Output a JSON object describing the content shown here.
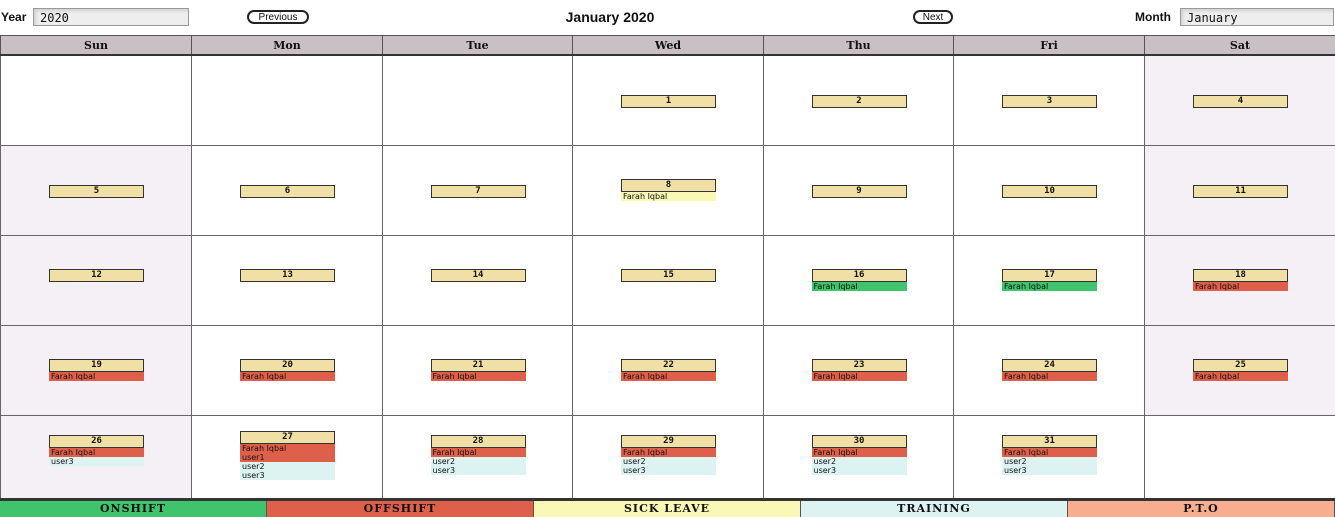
{
  "header": {
    "year_label": "Year",
    "year_value": "2020",
    "prev_label": "Previous",
    "title": "January 2020",
    "next_label": "Next",
    "month_label": "Month",
    "month_value": "January"
  },
  "weekdays": [
    "Sun",
    "Mon",
    "Tue",
    "Wed",
    "Thu",
    "Fri",
    "Sat"
  ],
  "weeks": [
    [
      {
        "day": "",
        "weekend": false,
        "events": []
      },
      {
        "day": "",
        "weekend": false,
        "events": []
      },
      {
        "day": "",
        "weekend": false,
        "events": []
      },
      {
        "day": "1",
        "weekend": false,
        "events": []
      },
      {
        "day": "2",
        "weekend": false,
        "events": []
      },
      {
        "day": "3",
        "weekend": false,
        "events": []
      },
      {
        "day": "4",
        "weekend": true,
        "events": []
      }
    ],
    [
      {
        "day": "5",
        "weekend": true,
        "events": []
      },
      {
        "day": "6",
        "weekend": false,
        "events": []
      },
      {
        "day": "7",
        "weekend": false,
        "events": []
      },
      {
        "day": "8",
        "weekend": false,
        "events": [
          {
            "name": "Farah Iqbal",
            "type": "sick"
          }
        ]
      },
      {
        "day": "9",
        "weekend": false,
        "events": []
      },
      {
        "day": "10",
        "weekend": false,
        "events": []
      },
      {
        "day": "11",
        "weekend": true,
        "events": []
      }
    ],
    [
      {
        "day": "12",
        "weekend": true,
        "events": []
      },
      {
        "day": "13",
        "weekend": false,
        "events": []
      },
      {
        "day": "14",
        "weekend": false,
        "events": []
      },
      {
        "day": "15",
        "weekend": false,
        "events": []
      },
      {
        "day": "16",
        "weekend": false,
        "events": [
          {
            "name": "Farah Iqbal",
            "type": "onshift"
          }
        ]
      },
      {
        "day": "17",
        "weekend": false,
        "events": [
          {
            "name": "Farah Iqbal",
            "type": "onshift"
          }
        ]
      },
      {
        "day": "18",
        "weekend": true,
        "events": [
          {
            "name": "Farah Iqbal",
            "type": "offshift"
          }
        ]
      }
    ],
    [
      {
        "day": "19",
        "weekend": true,
        "events": [
          {
            "name": "Farah Iqbal",
            "type": "offshift"
          }
        ]
      },
      {
        "day": "20",
        "weekend": false,
        "events": [
          {
            "name": "Farah Iqbal",
            "type": "offshift"
          }
        ]
      },
      {
        "day": "21",
        "weekend": false,
        "events": [
          {
            "name": "Farah Iqbal",
            "type": "offshift"
          }
        ]
      },
      {
        "day": "22",
        "weekend": false,
        "events": [
          {
            "name": "Farah Iqbal",
            "type": "offshift"
          }
        ]
      },
      {
        "day": "23",
        "weekend": false,
        "events": [
          {
            "name": "Farah Iqbal",
            "type": "offshift"
          }
        ]
      },
      {
        "day": "24",
        "weekend": false,
        "events": [
          {
            "name": "Farah Iqbal",
            "type": "offshift"
          }
        ]
      },
      {
        "day": "25",
        "weekend": true,
        "events": [
          {
            "name": "Farah Iqbal",
            "type": "offshift"
          }
        ]
      }
    ],
    [
      {
        "day": "26",
        "weekend": true,
        "events": [
          {
            "name": "Farah Iqbal",
            "type": "offshift"
          },
          {
            "name": "user3",
            "type": "training"
          }
        ]
      },
      {
        "day": "27",
        "weekend": false,
        "events": [
          {
            "name": "Farah Iqbal",
            "type": "offshift"
          },
          {
            "name": "user1",
            "type": "offshift"
          },
          {
            "name": "user2",
            "type": "training"
          },
          {
            "name": "user3",
            "type": "training"
          }
        ]
      },
      {
        "day": "28",
        "weekend": false,
        "events": [
          {
            "name": "Farah Iqbal",
            "type": "offshift"
          },
          {
            "name": "user2",
            "type": "training"
          },
          {
            "name": "user3",
            "type": "training"
          }
        ]
      },
      {
        "day": "29",
        "weekend": false,
        "events": [
          {
            "name": "Farah Iqbal",
            "type": "offshift"
          },
          {
            "name": "user2",
            "type": "training"
          },
          {
            "name": "user3",
            "type": "training"
          }
        ]
      },
      {
        "day": "30",
        "weekend": false,
        "events": [
          {
            "name": "Farah Iqbal",
            "type": "offshift"
          },
          {
            "name": "user2",
            "type": "training"
          },
          {
            "name": "user3",
            "type": "training"
          }
        ]
      },
      {
        "day": "31",
        "weekend": false,
        "events": [
          {
            "name": "Farah Iqbal",
            "type": "offshift"
          },
          {
            "name": "user2",
            "type": "training"
          },
          {
            "name": "user3",
            "type": "training"
          }
        ]
      },
      {
        "day": "",
        "weekend": false,
        "events": []
      }
    ]
  ],
  "legend": [
    {
      "label": "ONSHIFT",
      "type": "onshift",
      "color": "#3fc36d"
    },
    {
      "label": "OFFSHIFT",
      "type": "offshift",
      "color": "#df604a"
    },
    {
      "label": "SICK LEAVE",
      "type": "sick",
      "color": "#f9f8b4"
    },
    {
      "label": "TRAINING",
      "type": "training",
      "color": "#dcf3f2"
    },
    {
      "label": "P.T.O",
      "type": "pto",
      "color": "#f7ad8e"
    }
  ],
  "colors": {
    "day_number_bg": "#f0e0a6",
    "weekend_bg": "#f5eff6",
    "header_bg": "#c8c0c4"
  }
}
